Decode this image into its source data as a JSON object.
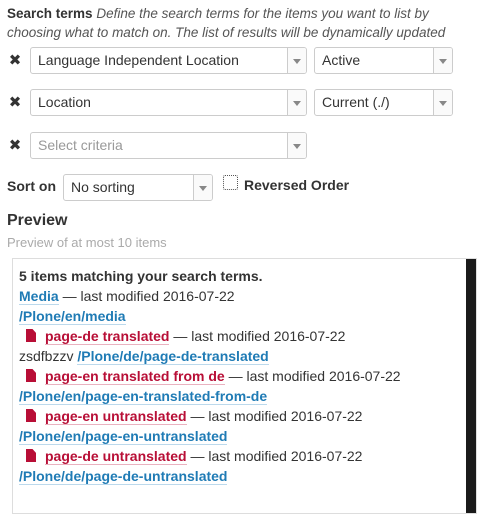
{
  "intro": {
    "title": "Search terms",
    "description": "Define the search terms for the items you want to list by choosing what to match on. The list of results will be dynamically updated"
  },
  "criteria": [
    {
      "remove_icon": "✖",
      "field": "Language Independent Location",
      "operator": "Active"
    },
    {
      "remove_icon": "✖",
      "field": "Location",
      "operator": "Current (./)"
    },
    {
      "remove_icon": "✖",
      "field_placeholder": "Select criteria"
    }
  ],
  "sort": {
    "label": "Sort on",
    "value": "No sorting",
    "reversed_label": "Reversed Order",
    "reversed_checked": false
  },
  "preview": {
    "title": "Preview",
    "subtitle": "Preview of at most 10 items",
    "count_text": "5 items matching your search terms.",
    "items": [
      {
        "title": "Media",
        "meta": " — last modified 2016-07-22",
        "path": "/Plone/en/media",
        "kind": "folder"
      },
      {
        "title": "page-de translated",
        "meta": " — last modified 2016-07-22",
        "prefix": "zsdfbzzv ",
        "path": "/Plone/de/page-de-translated",
        "kind": "page"
      },
      {
        "title": "page-en translated from de",
        "meta": " — last modified 2016-07-22",
        "path": "/Plone/en/page-en-translated-from-de",
        "kind": "page"
      },
      {
        "title": "page-en untranslated",
        "meta": " — last modified 2016-07-22",
        "path": "/Plone/en/page-en-untranslated",
        "kind": "page"
      },
      {
        "title": "page-de untranslated",
        "meta": " — last modified 2016-07-22",
        "path": "/Plone/de/page-de-untranslated",
        "kind": "page"
      }
    ]
  },
  "colors": {
    "link": "#1f7bb5",
    "page_link": "#b80e36"
  }
}
